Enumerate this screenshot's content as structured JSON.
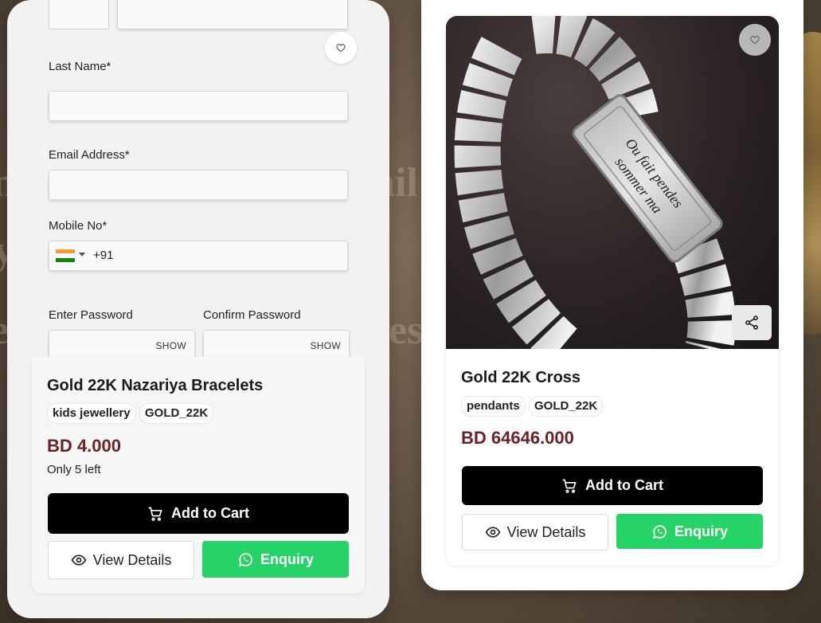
{
  "background": {
    "texts": [
      "n",
      "ail",
      "y",
      "e",
      "es"
    ]
  },
  "form": {
    "last_name_label": "Last Name*",
    "email_label": "Email Address*",
    "mobile_label": "Mobile No*",
    "mobile_code": "+91",
    "country_flag": "india-flag-icon",
    "password_label": "Enter Password",
    "confirm_password_label": "Confirm Password",
    "show_label": "SHOW"
  },
  "products": [
    {
      "title": "Gold 22K Nazariya Bracelets",
      "tags": [
        "kids jewellery",
        "GOLD_22K"
      ],
      "price": "BD 4.000",
      "stock": "Only 5 left",
      "add_to_cart": "Add to Cart",
      "view_details": "View Details",
      "enquiry": "Enquiry"
    },
    {
      "title": "Gold 22K Cross",
      "tags": [
        "pendants",
        "GOLD_22K"
      ],
      "price": "BD 64646.000",
      "add_to_cart": "Add to Cart",
      "view_details": "View Details",
      "enquiry": "Enquiry",
      "image_engraving": [
        "Ou fait pendes",
        "sommer ma"
      ]
    }
  ],
  "icons": {
    "wishlist": "heart-icon",
    "share": "share-icon",
    "cart": "cart-icon",
    "view": "eye-icon",
    "whatsapp": "whatsapp-icon"
  },
  "colors": {
    "price": "#6b2424",
    "enquiry": "#25d366",
    "cart_button": "#000000"
  }
}
